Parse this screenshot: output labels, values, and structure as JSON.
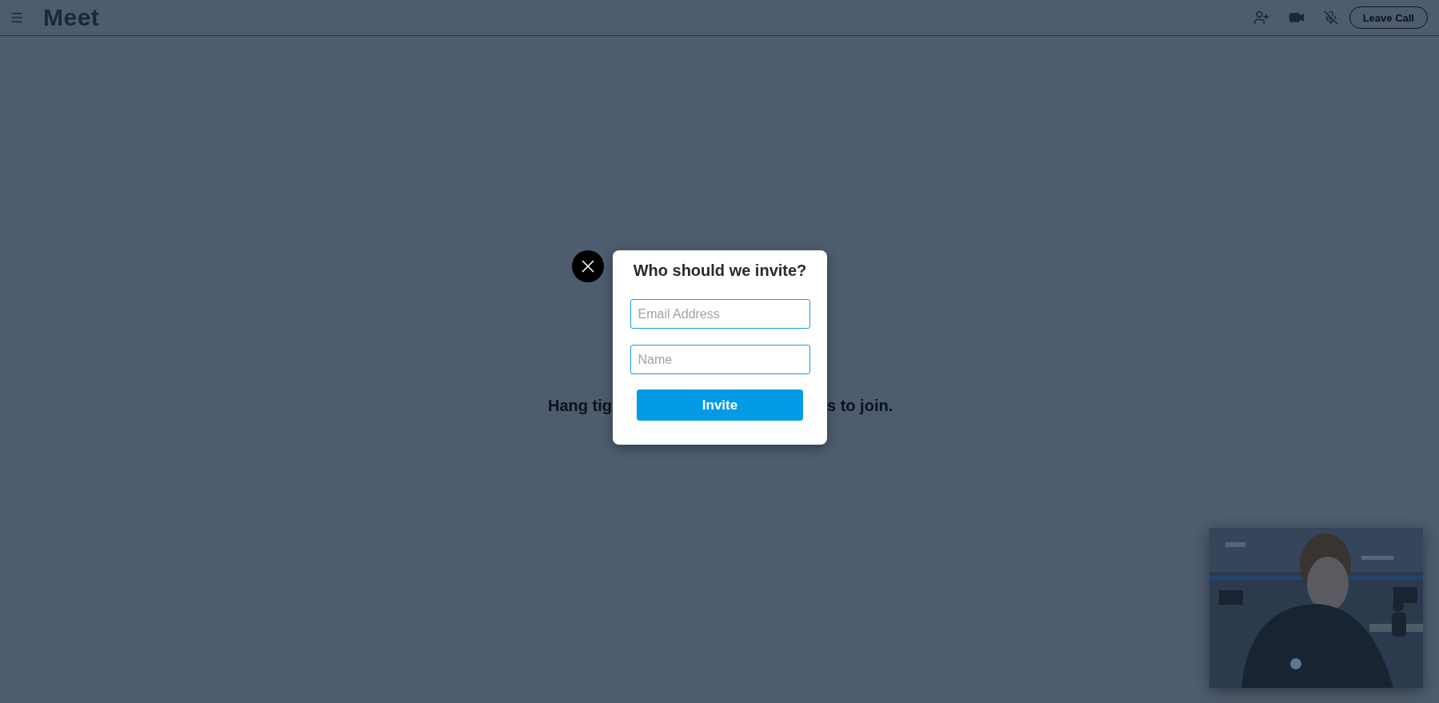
{
  "header": {
    "logo": "Meet",
    "leave_button": "Leave Call"
  },
  "status_message": {
    "left_part": "Hang tig",
    "right_part": "s to join."
  },
  "invite_dialog": {
    "title": "Who should we invite?",
    "fields": [
      {
        "placeholder": "Email Address"
      },
      {
        "placeholder": "Name"
      }
    ],
    "submit_button": "Invite"
  }
}
